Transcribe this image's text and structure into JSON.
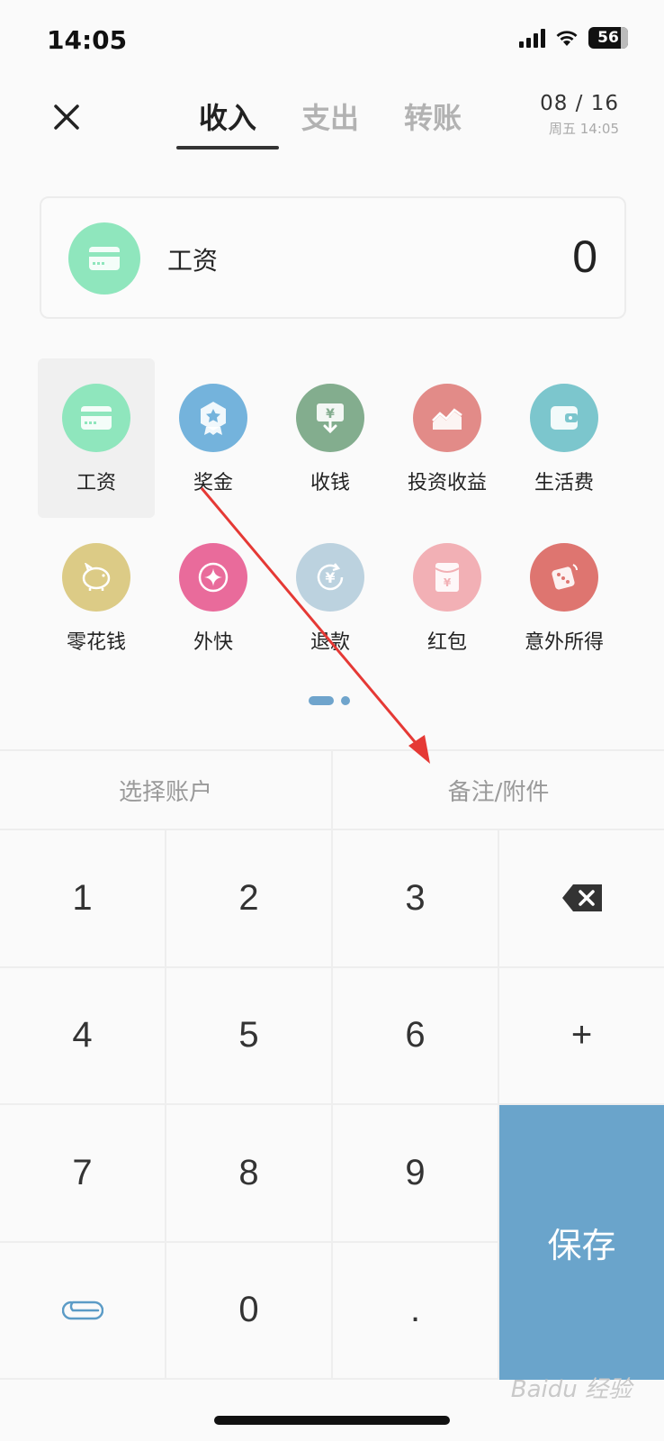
{
  "status_bar": {
    "time": "14:05",
    "battery": "56"
  },
  "header": {
    "tabs": [
      {
        "label": "收入",
        "active": true
      },
      {
        "label": "支出",
        "active": false
      },
      {
        "label": "转账",
        "active": false
      }
    ],
    "date": "08 / 16",
    "weekday_time": "周五 14:05"
  },
  "amount_card": {
    "category": "工资",
    "amount": "0",
    "icon": "card-icon",
    "color": "#8fe6bd"
  },
  "categories": [
    {
      "label": "工资",
      "icon": "card-icon",
      "color": "#8fe6bd",
      "selected": true
    },
    {
      "label": "奖金",
      "icon": "medal-icon",
      "color": "#74b3dc",
      "selected": false
    },
    {
      "label": "收钱",
      "icon": "receive-money-icon",
      "color": "#83ad8e",
      "selected": false
    },
    {
      "label": "投资收益",
      "icon": "chart-up-icon",
      "color": "#e28b88",
      "selected": false
    },
    {
      "label": "生活费",
      "icon": "wallet-icon",
      "color": "#7cc6cd",
      "selected": false
    },
    {
      "label": "零花钱",
      "icon": "piggy-bank-icon",
      "color": "#dccb86",
      "selected": false
    },
    {
      "label": "外快",
      "icon": "sparkle-icon",
      "color": "#e96b9b",
      "selected": false
    },
    {
      "label": "退款",
      "icon": "refund-icon",
      "color": "#bcd2df",
      "selected": false
    },
    {
      "label": "红包",
      "icon": "red-envelope-icon",
      "color": "#f2b0b5",
      "selected": false
    },
    {
      "label": "意外所得",
      "icon": "dice-icon",
      "color": "#de7570",
      "selected": false
    }
  ],
  "options": {
    "account": "选择账户",
    "note": "备注/附件"
  },
  "keypad": {
    "k1": "1",
    "k2": "2",
    "k3": "3",
    "k4": "4",
    "k5": "5",
    "k6": "6",
    "plus": "+",
    "k7": "7",
    "k8": "8",
    "k9": "9",
    "k0": "0",
    "dot": ".",
    "save": "保存"
  },
  "watermark": "Baidu 经验"
}
